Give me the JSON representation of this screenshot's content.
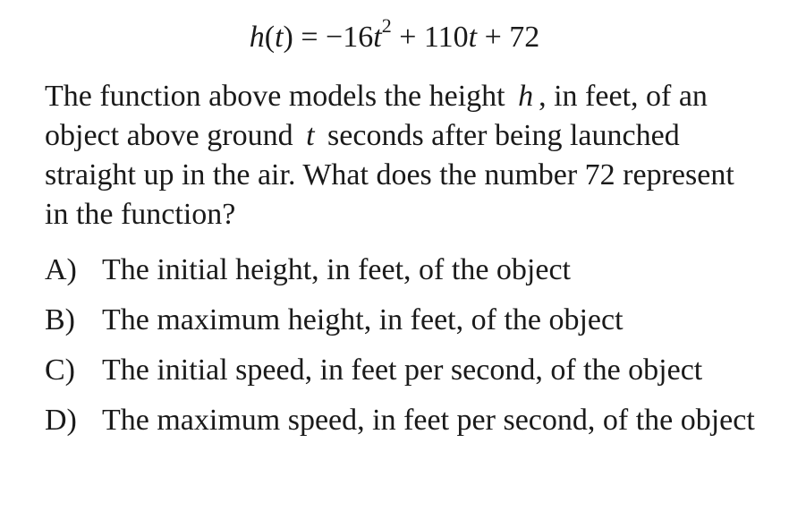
{
  "formula": {
    "func": "h",
    "lparen": "(",
    "var": "t",
    "rparen": ")",
    "equals": " = ",
    "coef_a": "−16",
    "var2": "t",
    "exp": "2",
    "plus_b": " + 110",
    "var3": "t",
    "plus_c": " + 72"
  },
  "question": {
    "part1": "The function above models the height",
    "var_h": "h",
    "part2": ", in feet, of an object above ground",
    "var_t": "t",
    "part3": "seconds after being launched straight up in the air.  What does the number 72 represent in the function?"
  },
  "choices": [
    {
      "letter": "A)",
      "text": "The initial height, in feet, of the object"
    },
    {
      "letter": "B)",
      "text": "The maximum height, in feet, of the object"
    },
    {
      "letter": "C)",
      "text": "The initial speed, in feet per second, of the object"
    },
    {
      "letter": "D)",
      "text": "The maximum speed, in feet per second, of the object"
    }
  ]
}
